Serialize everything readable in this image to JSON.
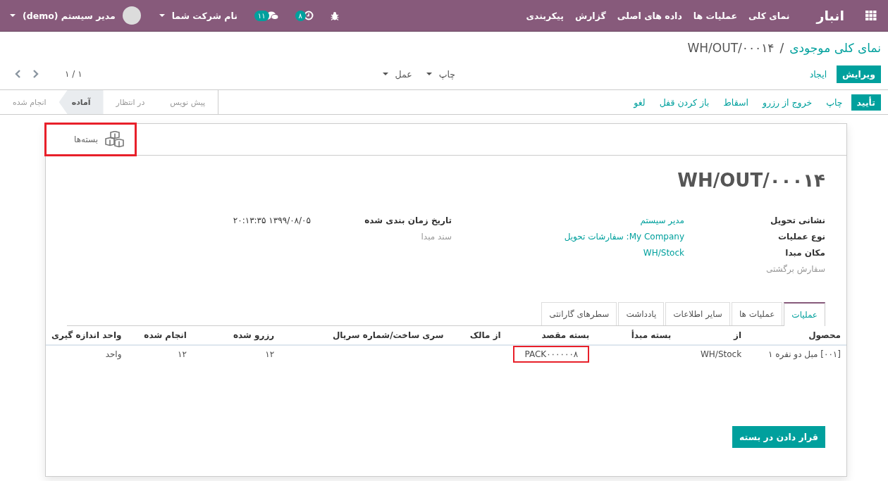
{
  "navbar": {
    "brand": "انبار",
    "menu": [
      "نمای کلی",
      "عملیات ها",
      "داده های اصلی",
      "گزارش",
      "پیکربندی"
    ],
    "activity_count": "۸",
    "message_count": "۱۱",
    "company": "نام شرکت شما",
    "user": "مدیر سیستم (demo)"
  },
  "breadcrumb": {
    "parent": "نمای کلی موجودی",
    "separator": "/",
    "current": "WH/OUT/۰۰۰۱۴"
  },
  "control_buttons": [
    {
      "label": "ویرایش",
      "primary": true
    },
    {
      "label": "ایجاد",
      "primary": false
    }
  ],
  "dropdowns": [
    "چاپ",
    "عمل"
  ],
  "pager": "۱ / ۱",
  "header_buttons": [
    {
      "label": "تأیید",
      "primary": true
    },
    {
      "label": "چاپ",
      "primary": false
    },
    {
      "label": "خروج از رزرو",
      "primary": false
    },
    {
      "label": "اسقاط",
      "primary": false
    },
    {
      "label": "باز کردن قفل",
      "primary": false
    },
    {
      "label": "لغو",
      "primary": false
    }
  ],
  "status_steps": [
    {
      "label": "پیش نویس",
      "selected": false
    },
    {
      "label": "در انتظار",
      "selected": false
    },
    {
      "label": "آماده",
      "selected": true
    },
    {
      "label": "انجام شده",
      "selected": false
    }
  ],
  "smart_button": {
    "label": "بسته‌ها",
    "highlighted": true
  },
  "title": "WH/OUT/۰۰۰۱۴",
  "fields_main": [
    {
      "label": "نشانی تحویل",
      "value": "مدیر سیستم"
    },
    {
      "label": "نوع عملیات",
      "value": "My Company: سفارشات تحویل"
    },
    {
      "label": "مکان مبدا",
      "value": "WH/Stock"
    },
    {
      "label": "سفارش برگشتی"
    }
  ],
  "fields_side": [
    {
      "label": "تاریخ زمان بندی شده",
      "value": "۱۳۹۹/۰۸/۰۵ ۲۰:۱۳:۳۵"
    },
    {
      "label": "سند مبدا"
    }
  ],
  "tabs": [
    {
      "label": "عملیات",
      "selected": true
    },
    {
      "label": "عملیات ها",
      "selected": false
    },
    {
      "label": "سایر اطلاعات",
      "selected": false
    },
    {
      "label": "یادداشت",
      "selected": false
    },
    {
      "label": "سطرهای گارانتی",
      "selected": false
    }
  ],
  "table": {
    "columns": [
      "محصول",
      "از",
      "بسته مبدأ",
      "بسته مقصد",
      "از مالک",
      "سری ساخت/شماره سریال",
      "رزرو شده",
      "انجام شده",
      "واحد اندازه گیری"
    ],
    "rows": [
      {
        "cells": [
          {
            "text": "[۰۰۱] مبل دو نفره ۱",
            "highlighted": false
          },
          {
            "text": "WH/Stock",
            "highlighted": false
          },
          null,
          {
            "text": "PACK۰۰۰۰۰۰۸",
            "highlighted": true
          },
          null,
          null,
          {
            "text": "۱۲",
            "highlighted": false
          },
          {
            "text": "۱۲",
            "highlighted": false
          },
          {
            "text": "واحد",
            "highlighted": false
          }
        ]
      }
    ]
  },
  "put_in_pack_button": "قرار دادن در بسته"
}
